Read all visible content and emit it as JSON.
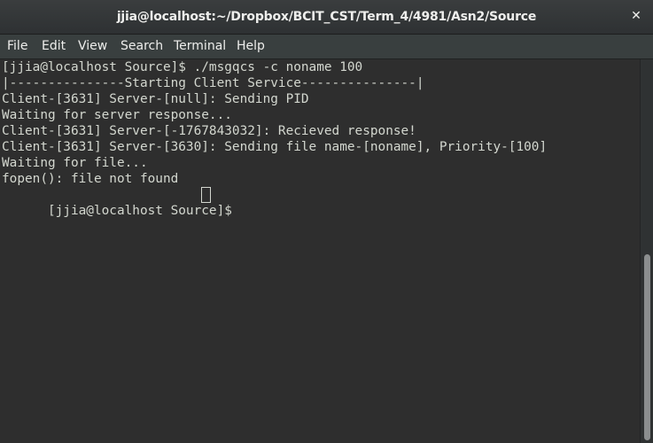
{
  "window": {
    "title": "jjia@localhost:~/Dropbox/BCIT_CST/Term_4/4981/Asn2/Source",
    "close_label": "✕"
  },
  "menu": {
    "items": [
      "File",
      "Edit",
      "View",
      "Search",
      "Terminal",
      "Help"
    ]
  },
  "terminal": {
    "lines": [
      "[jjia@localhost Source]$ ./msgqcs -c noname 100",
      "|---------------Starting Client Service---------------|",
      "Client-[3631] Server-[null]: Sending PID",
      "Waiting for server response...",
      "Client-[3631] Server-[-1767843032]: Recieved response!",
      "Client-[3631] Server-[3630]: Sending file name-[noname], Priority-[100]",
      "Waiting for file...",
      "fopen(): file not found",
      "[jjia@localhost Source]$ "
    ]
  },
  "colors": {
    "terminal_background": "#2e2e2e",
    "terminal_text": "#d3d7cf",
    "titlebar": "#33373a"
  }
}
